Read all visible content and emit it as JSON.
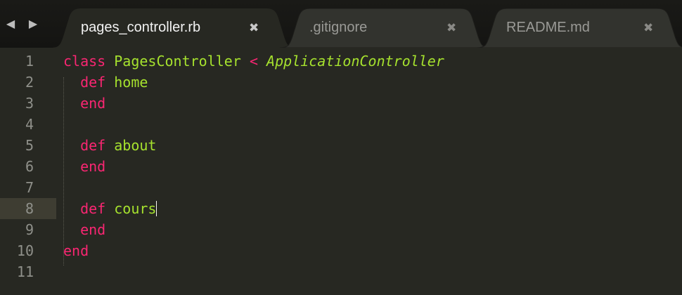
{
  "navigation": {
    "back_icon": "◀",
    "forward_icon": "▶"
  },
  "tabs": [
    {
      "label": "pages_controller.rb",
      "close_icon": "✖",
      "active": true
    },
    {
      "label": ".gitignore",
      "close_icon": "✖",
      "active": false
    },
    {
      "label": "README.md",
      "close_icon": "✖",
      "active": false
    }
  ],
  "editor": {
    "current_line": 8,
    "colors": {
      "background": "#272822",
      "keyword": "#f92672",
      "class_name": "#a6e22e",
      "function_name": "#a6e22e",
      "line_number": "#8f908a",
      "current_line_highlight": "#3e3d32"
    },
    "lines": [
      {
        "number": "1",
        "tokens": [
          {
            "text": "class",
            "kind": "kw"
          },
          {
            "text": " ",
            "kind": "plain"
          },
          {
            "text": "PagesController",
            "kind": "cls"
          },
          {
            "text": " ",
            "kind": "plain"
          },
          {
            "text": "<",
            "kind": "op"
          },
          {
            "text": " ",
            "kind": "plain"
          },
          {
            "text": "ApplicationController",
            "kind": "inh"
          }
        ]
      },
      {
        "number": "2",
        "tokens": [
          {
            "text": "  ",
            "kind": "plain"
          },
          {
            "text": "def",
            "kind": "kw"
          },
          {
            "text": " ",
            "kind": "plain"
          },
          {
            "text": "home",
            "kind": "fn"
          }
        ]
      },
      {
        "number": "3",
        "tokens": [
          {
            "text": "  ",
            "kind": "plain"
          },
          {
            "text": "end",
            "kind": "kw"
          }
        ]
      },
      {
        "number": "4",
        "tokens": []
      },
      {
        "number": "5",
        "tokens": [
          {
            "text": "  ",
            "kind": "plain"
          },
          {
            "text": "def",
            "kind": "kw"
          },
          {
            "text": " ",
            "kind": "plain"
          },
          {
            "text": "about",
            "kind": "fn"
          }
        ]
      },
      {
        "number": "6",
        "tokens": [
          {
            "text": "  ",
            "kind": "plain"
          },
          {
            "text": "end",
            "kind": "kw"
          }
        ]
      },
      {
        "number": "7",
        "tokens": []
      },
      {
        "number": "8",
        "tokens": [
          {
            "text": "  ",
            "kind": "plain"
          },
          {
            "text": "def",
            "kind": "kw"
          },
          {
            "text": " ",
            "kind": "plain"
          },
          {
            "text": "cours",
            "kind": "fn"
          }
        ]
      },
      {
        "number": "9",
        "tokens": [
          {
            "text": "  ",
            "kind": "plain"
          },
          {
            "text": "end",
            "kind": "kw"
          }
        ]
      },
      {
        "number": "10",
        "tokens": [
          {
            "text": "end",
            "kind": "kw"
          }
        ]
      },
      {
        "number": "11",
        "tokens": []
      }
    ]
  }
}
